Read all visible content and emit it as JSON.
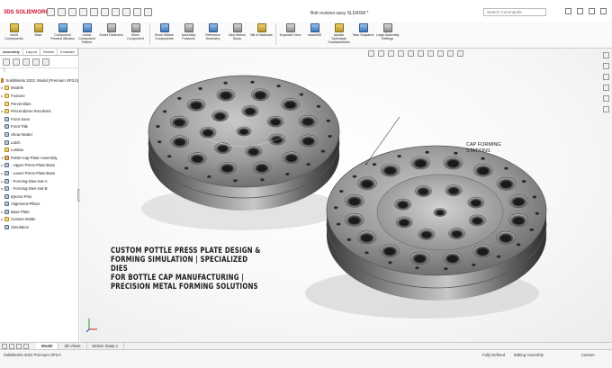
{
  "app": {
    "logo": "3DS SOLIDWORKS",
    "doc_title": "Bolt revision-assy SLDASM *",
    "search_placeholder": "Search Commands"
  },
  "ribbon": [
    {
      "label": "Insert Components",
      "icon": "insert-components-icon"
    },
    {
      "label": "Mate",
      "icon": "mate-icon"
    },
    {
      "label": "Component Preview Window",
      "icon": "preview-icon"
    },
    {
      "label": "Linear Component Pattern",
      "icon": "linear-pattern-icon"
    },
    {
      "label": "Smart Fasteners",
      "icon": "fastener-icon"
    },
    {
      "label": "Move Component",
      "icon": "move-icon"
    },
    {
      "label": "Show Hidden Components",
      "icon": "show-hidden-icon"
    },
    {
      "label": "Assembly Features",
      "icon": "assembly-features-icon"
    },
    {
      "label": "Reference Geometry",
      "icon": "reference-geometry-icon"
    },
    {
      "label": "New Motion Study",
      "icon": "motion-study-icon"
    },
    {
      "label": "Bill of Materials",
      "icon": "bom-icon"
    },
    {
      "label": "Exploded View",
      "icon": "explode-icon"
    },
    {
      "label": "Instant3D",
      "icon": "instant3d-icon"
    },
    {
      "label": "Update Speedpak Subassemblies",
      "icon": "speedpak-icon"
    },
    {
      "label": "Take Snapshot",
      "icon": "snapshot-icon"
    },
    {
      "label": "Large Assembly Settings",
      "icon": "large-assembly-icon"
    }
  ],
  "panel_tabs": [
    "Assembly",
    "Layout",
    "Sketch",
    "Evaluate"
  ],
  "tree": [
    {
      "label": "SolidWorks 2023, Model (Premium SP3.0)",
      "arrow": "",
      "kind": "a"
    },
    {
      "label": "Models",
      "arrow": "▸",
      "kind": "f"
    },
    {
      "label": "Footone",
      "arrow": "▸",
      "kind": "f"
    },
    {
      "label": "Perverslites",
      "arrow": "",
      "kind": "f"
    },
    {
      "label": "Precendores Resolents",
      "arrow": "▸",
      "kind": "f"
    },
    {
      "label": "Front Sans",
      "arrow": "",
      "kind": "p"
    },
    {
      "label": "Front Title",
      "arrow": "",
      "kind": "p"
    },
    {
      "label": "Show Model",
      "arrow": "",
      "kind": "p"
    },
    {
      "label": "Latch",
      "arrow": "",
      "kind": "p"
    },
    {
      "label": "Lotstas",
      "arrow": "",
      "kind": "f"
    },
    {
      "label": "Pottle-Cap-Plate-Assembly",
      "arrow": "▾",
      "kind": "a"
    },
    {
      "label": "- Upper-Press-Plate-Base",
      "arrow": "▸",
      "kind": "p"
    },
    {
      "label": "- Lower-Press-Plate-Base",
      "arrow": "▸",
      "kind": "p"
    },
    {
      "label": "- Forming-Dies-Set-A",
      "arrow": "▸",
      "kind": "p"
    },
    {
      "label": "- Forming-Dies-Set-B",
      "arrow": "▸",
      "kind": "p"
    },
    {
      "label": "Ejector-Pins",
      "arrow": "",
      "kind": "p"
    },
    {
      "label": "Alignment-Pillars",
      "arrow": "",
      "kind": "p"
    },
    {
      "label": "Base Plate",
      "arrow": "▸",
      "kind": "p"
    },
    {
      "label": "Custom Molds",
      "arrow": "▸",
      "kind": "f"
    },
    {
      "label": "Simulation",
      "arrow": "",
      "kind": "p"
    }
  ],
  "viewport": {
    "caption_lines": [
      "CUSTOM POTTLE PRESS PLATE DESIGN &",
      "FORMING SIMULATION | SPECIALIZED DIES",
      "FOR BOTTLE CAP MANUFACTURING |",
      "PRECISION METAL FORMING SOLUTIONS"
    ],
    "callout_lines": [
      "CAP FORMING",
      "STATIONS"
    ]
  },
  "bottom_tabs": [
    "Model",
    "3D Views",
    "Motion Study 1"
  ],
  "status": {
    "left": "SolidWorks 2023 Premium SP3.0",
    "state": "Fully Defined",
    "mode": "Editing Assembly",
    "units": "Custom"
  }
}
